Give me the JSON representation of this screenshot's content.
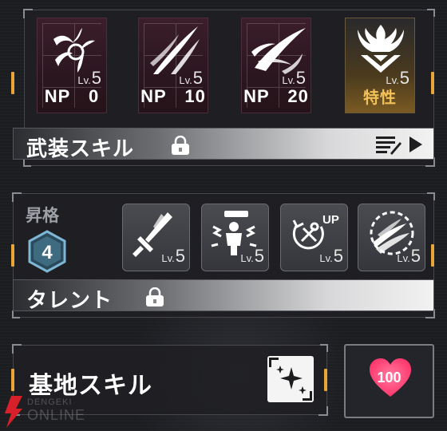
{
  "weapon_skills": {
    "tiles": [
      {
        "icon": "claw-burst-icon",
        "lv_prefix": "Lv.",
        "lv_value": "5",
        "label": "NP　0"
      },
      {
        "icon": "blade-slash-icon",
        "lv_prefix": "Lv.",
        "lv_value": "5",
        "label": "NP　10"
      },
      {
        "icon": "whirlwind-slash-icon",
        "lv_prefix": "Lv.",
        "lv_value": "5",
        "label": "NP　20"
      },
      {
        "icon": "flame-emblem-icon",
        "lv_prefix": "Lv.",
        "lv_value": "5",
        "label": "特性"
      }
    ],
    "bar_title": "武装スキル",
    "lock_icon": "padlock-icon",
    "list_icon": "notes-list-icon",
    "arrow_icon": "play-arrow-icon"
  },
  "ascension": {
    "label": "昇格",
    "rank": "4",
    "talents": [
      {
        "icon": "sword-up-icon",
        "lv_prefix": "Lv.",
        "lv_value": "5"
      },
      {
        "icon": "person-shock-icon",
        "lv_prefix": "Lv.",
        "lv_value": "5"
      },
      {
        "icon": "tools-up-icon",
        "up_text": "UP",
        "lv_prefix": "Lv.",
        "lv_value": "5"
      },
      {
        "icon": "claw-orb-icon",
        "lv_prefix": "Lv.",
        "lv_value": "5"
      }
    ],
    "bar_title": "タレント"
  },
  "base": {
    "title": "基地スキル",
    "icon": "sparkle-frame-icon",
    "affection": "100",
    "heart_icon": "heart-icon"
  },
  "watermark": {
    "line1": "DENGEKI",
    "line2": "ONLINE"
  },
  "colors": {
    "accent": "#e8a53a",
    "trait_gold": "#f2c15a",
    "heart_pink": "#ff3f74"
  }
}
